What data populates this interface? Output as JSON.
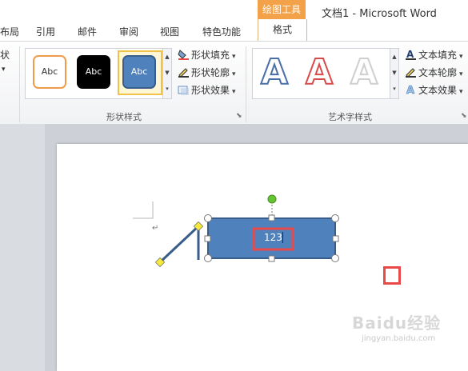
{
  "window": {
    "title": "文档1 - Microsoft Word"
  },
  "tabs": [
    {
      "label": "布局"
    },
    {
      "label": "引用"
    },
    {
      "label": "邮件"
    },
    {
      "label": "审阅"
    },
    {
      "label": "视图"
    },
    {
      "label": "特色功能"
    }
  ],
  "context_tab": {
    "group_label": "绘图工具",
    "tab_label": "格式"
  },
  "ribbon": {
    "shape_styles": {
      "group_label": "形状样式",
      "gallery": [
        {
          "label": "Abc"
        },
        {
          "label": "Abc"
        },
        {
          "label": "Abc"
        }
      ],
      "fill_label": "形状填充",
      "outline_label": "形状轮廓",
      "effect_label": "形状效果"
    },
    "wordart": {
      "group_label": "艺术字样式",
      "gallery_letter": "A",
      "fill_label": "文本填充",
      "outline_label": "文本轮廓",
      "effect_label": "文本效果"
    },
    "left_cutoff": {
      "item1": "状",
      "item2": "▾"
    }
  },
  "document": {
    "textbox_text": "123",
    "paragraph_mark": "↵"
  },
  "watermark": {
    "text": "jingyan.baidu.com",
    "logo": "Baidu经验"
  },
  "colors": {
    "accent_orange": "#f3a24a",
    "shape_fill": "#4f81bd",
    "shape_border": "#385d8a",
    "highlight_red": "#e84a4a",
    "handle_green": "#65c432",
    "handle_yellow": "#f7e93b"
  }
}
